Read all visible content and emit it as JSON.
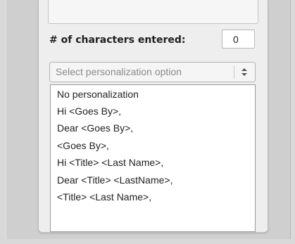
{
  "message_field": {
    "value": ""
  },
  "character_counter": {
    "label": "# of characters entered:",
    "value": "0"
  },
  "personalization_select": {
    "placeholder": "Select personalization option",
    "arrow_icon": "up-down-stepper-icon",
    "options": [
      "No personalization",
      "Hi <Goes By>,",
      "Dear <Goes By>,",
      "<Goes By>,",
      "Hi <Title> <Last Name>,",
      "Dear <Title> <LastName>,",
      "<Title> <Last Name>,"
    ]
  }
}
